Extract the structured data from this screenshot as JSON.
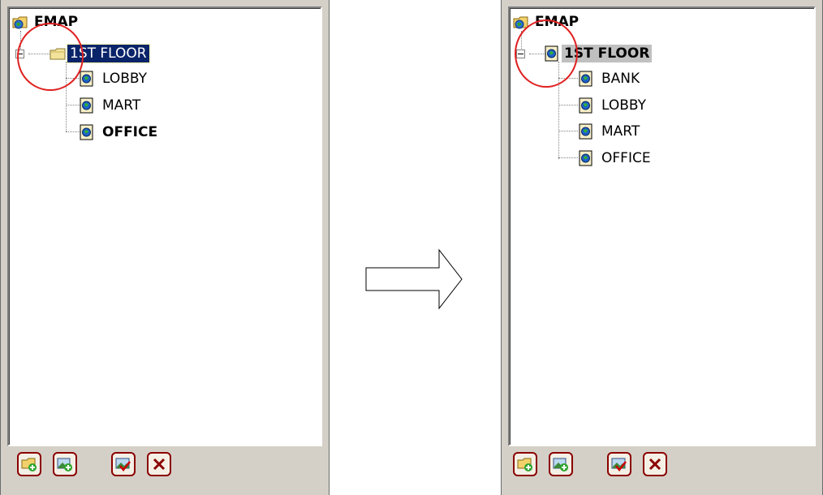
{
  "left_panel": {
    "root_label": "EMAP",
    "floor_label": "1ST FLOOR",
    "children": [
      "LOBBY",
      "MART",
      "OFFICE"
    ]
  },
  "right_panel": {
    "root_label": "EMAP",
    "floor_label": "1ST FLOOR",
    "children": [
      "BANK",
      "LOBBY",
      "MART",
      "OFFICE"
    ]
  },
  "toolbar": {
    "buttons": [
      "add-folder",
      "add-map",
      "edit-map",
      "delete"
    ]
  },
  "colors": {
    "selection": "#0a246a",
    "highlight_circle": "#e02020",
    "button_border": "#8b0000"
  }
}
